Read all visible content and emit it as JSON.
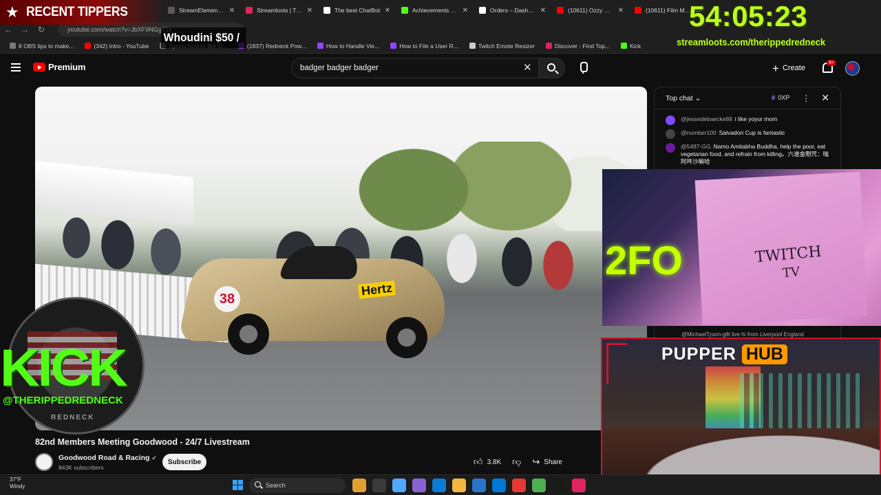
{
  "browser": {
    "tabs": [
      {
        "label": "StreamElements -",
        "color": "#5b5b5b"
      },
      {
        "label": "Streamloots | Ther",
        "color": "#e0245e"
      },
      {
        "label": "The best ChatBot",
        "color": "#ffffff"
      },
      {
        "label": "Achievements - Ki",
        "color": "#53fc18"
      },
      {
        "label": "Orders – Dashboa",
        "color": "#ffffff"
      },
      {
        "label": "(10611) Ozzy Osb",
        "color": "#ff0000"
      },
      {
        "label": "(10611) Film Musi",
        "color": "#ff0000"
      }
    ],
    "url": "youtube.com/watch?v=JbXF9NGgT1k",
    "bookmarks": [
      {
        "label": "8 OBS tips to make...",
        "color": "#7a7a7a"
      },
      {
        "label": "(342) Intro - YouTube",
        "color": "#ff0000"
      },
      {
        "label": "Sports Scores Bot O...",
        "color": "#7a7a7a"
      },
      {
        "label": "(1837) Redneck Pow...",
        "color": "#9146ff"
      },
      {
        "label": "How to Handle Vie...",
        "color": "#9146ff"
      },
      {
        "label": "How to File a User R...",
        "color": "#9146ff"
      },
      {
        "label": "Twitch Emote Resizer",
        "color": "#cccccc"
      },
      {
        "label": "Discover - Find Top...",
        "color": "#e0245e"
      },
      {
        "label": "Kick",
        "color": "#53fc18"
      }
    ]
  },
  "youtube": {
    "brand": "Premium",
    "search_query": "badger badger badger",
    "create_label": "Create",
    "notif_badge": "9+"
  },
  "video": {
    "title": "82nd Members Meeting Goodwood - 24/7 Livestream",
    "car_number": "38",
    "car_sponsor": "Hertz",
    "channel_name": "Goodwood Road & Racing",
    "verified_icon": "✔",
    "subscribers": "843K subscribers",
    "subscribe_label": "Subscribe",
    "likes": "3.8K",
    "share_label": "Share"
  },
  "chat": {
    "mode_label": "Top chat",
    "xp_label": "0XP",
    "messages": [
      {
        "author": "@jessedebaecke88",
        "text": "i like yoyur mom",
        "color": "#7c4dff"
      },
      {
        "author": "@number100",
        "text": "Salvadori Cup is fantastic",
        "color": "#444444"
      },
      {
        "author": "@5487-GG",
        "text": "Namo Amitabha Buddha, help the poor, eat vegetarian food, and refrain from killing。六道金剛咒：嗡阿吽沙嘛哈",
        "color": "#6a1b9a"
      }
    ],
    "bottom_message": "@MichaelTyson-g8t  live hi from Liverpool England"
  },
  "overlays": {
    "tippers_label": "RECENT TIPPERS",
    "ticker_text": "Whoudini $50 /",
    "timer": "54:05:23",
    "timer_url": "streamloots.com/therippedredneck",
    "kick_word": "KICK",
    "kick_handle": "@THERIPPEDREDNECK",
    "kick_sub": "REDNECK",
    "cam_box_text_1": "TWITCH",
    "cam_box_text_2": "TV",
    "hub_left": "PUPPER",
    "hub_right": "HUB"
  },
  "taskbar": {
    "temperature": "37°F",
    "condition": "Windy",
    "search_label": "Search",
    "icons": [
      "#e0a030",
      "#3a3a3a",
      "#4fa8ff",
      "#8a63d2",
      "#0a7cd6",
      "#f3b640",
      "#2a75c9",
      "#0078d4",
      "#e53935",
      "#4caf50",
      "#1a1a1a",
      "#e0245e"
    ]
  }
}
